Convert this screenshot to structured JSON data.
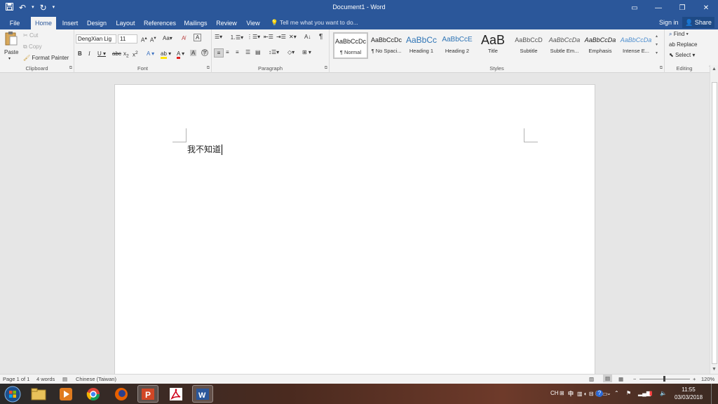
{
  "window": {
    "title": "Document1 - Word",
    "controls": {
      "ribbon_display": "▭",
      "minimize": "—",
      "restore": "❐",
      "close": "✕"
    }
  },
  "quick_access": {
    "save_icon": "save-icon",
    "undo_icon": "undo-icon",
    "redo_icon": "redo-icon",
    "customize_icon": "customize-icon"
  },
  "tabs": [
    "File",
    "Home",
    "Insert",
    "Design",
    "Layout",
    "References",
    "Mailings",
    "Review",
    "View"
  ],
  "active_tab": "Home",
  "tell_me": "Tell me what you want to do...",
  "account": {
    "sign_in": "Sign in",
    "share": "Share"
  },
  "ribbon": {
    "clipboard": {
      "label": "Clipboard",
      "paste": "Paste",
      "cut": "Cut",
      "copy": "Copy",
      "format_painter": "Format Painter"
    },
    "font": {
      "label": "Font",
      "font_name": "DengXian Lig",
      "font_size": "11"
    },
    "paragraph": {
      "label": "Paragraph"
    },
    "styles": {
      "label": "Styles",
      "items": [
        {
          "preview": "AaBbCcDc",
          "name": "¶ Normal"
        },
        {
          "preview": "AaBbCcDc",
          "name": "¶ No Spaci..."
        },
        {
          "preview": "AaBbCc",
          "name": "Heading 1"
        },
        {
          "preview": "AaBbCcE",
          "name": "Heading 2"
        },
        {
          "preview": "AaB",
          "name": "Title"
        },
        {
          "preview": "AaBbCcD",
          "name": "Subtitle"
        },
        {
          "preview": "AaBbCcDa",
          "name": "Subtle Em..."
        },
        {
          "preview": "AaBbCcDa",
          "name": "Emphasis"
        },
        {
          "preview": "AaBbCcDa",
          "name": "Intense E..."
        }
      ]
    },
    "editing": {
      "label": "Editing",
      "find": "Find",
      "replace": "Replace",
      "select": "Select"
    }
  },
  "document": {
    "text": "我不知道"
  },
  "status": {
    "page": "Page 1 of 1",
    "words": "4 words",
    "language": "Chinese (Taiwan)",
    "zoom": "120%",
    "zoom_minus": "−",
    "zoom_plus": "+"
  },
  "taskbar": {
    "apps": [
      "start-orb",
      "file-explorer",
      "media-player",
      "chrome",
      "firefox",
      "powerpoint",
      "acrobat",
      "word"
    ],
    "tray": {
      "lang": "CH",
      "ime": "中",
      "time": "11:55",
      "date": "03/03/2018"
    }
  },
  "colors": {
    "accent": "#2b579a",
    "ribbon": "#f3f3f3",
    "canvas": "#e6e6e6"
  }
}
